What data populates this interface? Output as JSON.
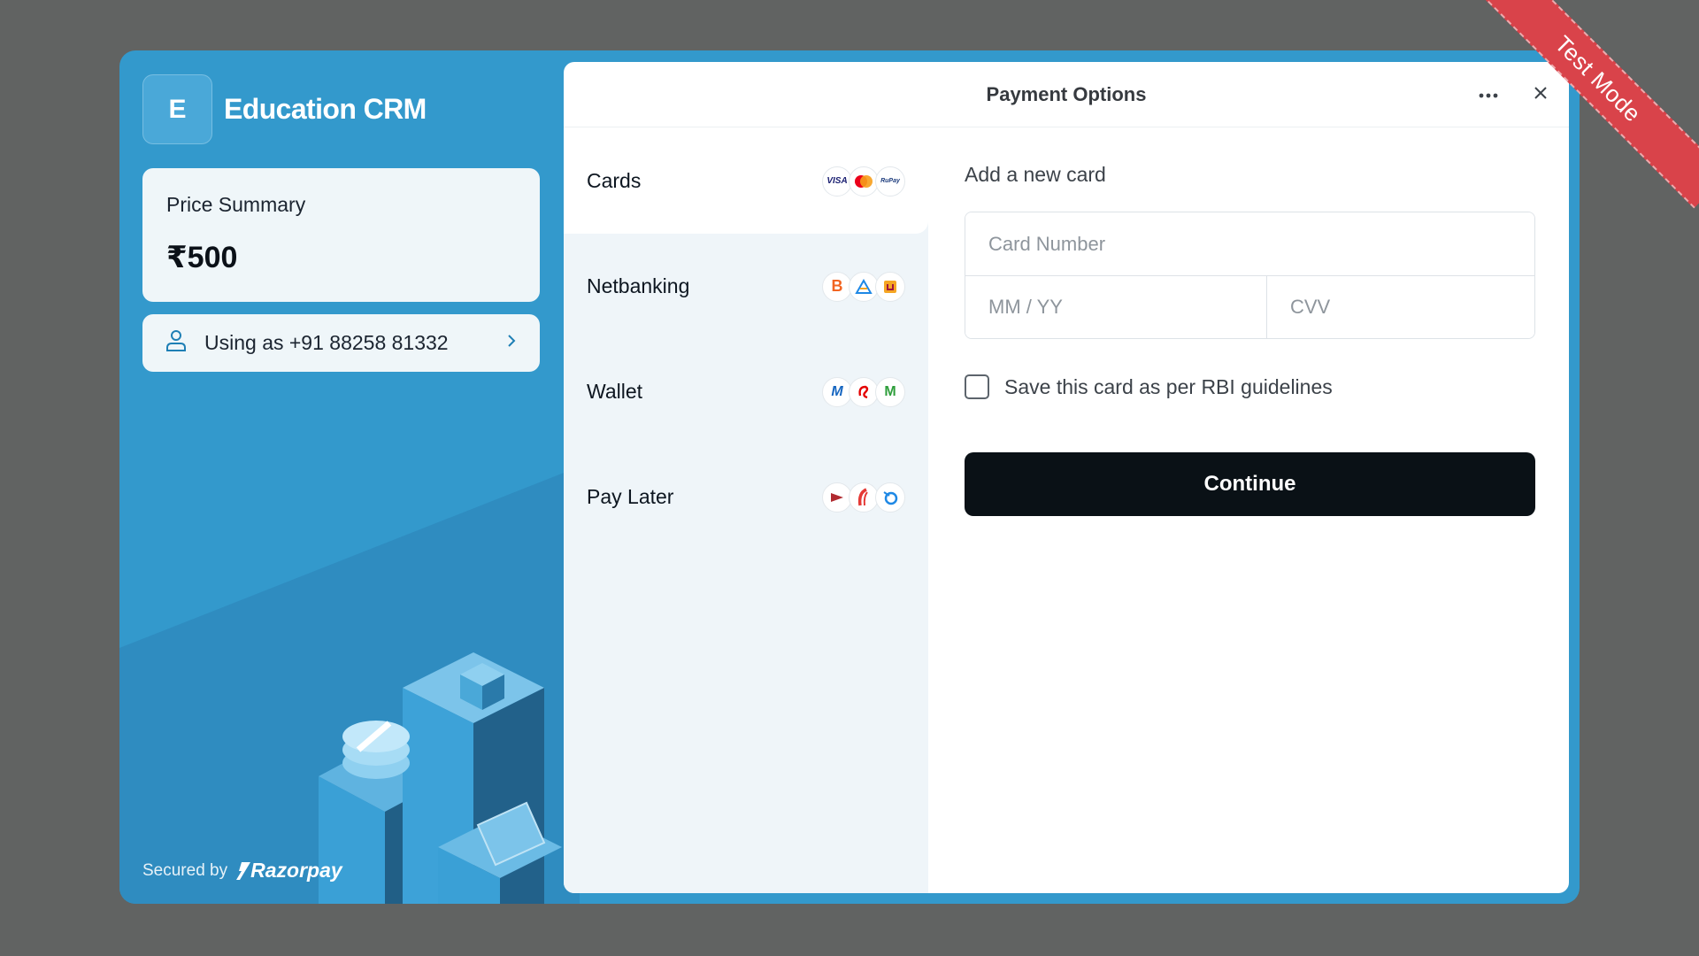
{
  "ribbon": {
    "label": "Test Mode"
  },
  "merchant": {
    "logo_letter": "E",
    "name": "Education CRM"
  },
  "price_summary": {
    "title": "Price Summary",
    "amount": "₹500"
  },
  "user": {
    "label": "Using as +91 88258 81332"
  },
  "footer": {
    "secured_by": "Secured by",
    "brand": "Razorpay"
  },
  "header": {
    "title": "Payment Options"
  },
  "methods": [
    {
      "label": "Cards",
      "icons": [
        "visa-icon",
        "mastercard-icon",
        "rupay-icon"
      ]
    },
    {
      "label": "Netbanking",
      "icons": [
        "bank-of-baroda-icon",
        "allahabad-bank-icon",
        "punjab-national-bank-icon"
      ]
    },
    {
      "label": "Wallet",
      "icons": [
        "mobikwik-icon",
        "airtel-payments-bank-icon",
        "jiomoney-icon"
      ]
    },
    {
      "label": "Pay Later",
      "icons": [
        "icici-paylater-icon",
        "lazypay-icon",
        "epaylater-icon"
      ]
    }
  ],
  "card_form": {
    "title": "Add a new card",
    "card_number_placeholder": "Card Number",
    "expiry_placeholder": "MM / YY",
    "cvv_placeholder": "CVV",
    "save_label": "Save this card as per RBI guidelines",
    "continue_label": "Continue"
  },
  "colors": {
    "background": "#616362",
    "brand_blue": "#3399cc",
    "button_dark": "#0a1116",
    "ribbon_red": "#d9434a"
  }
}
